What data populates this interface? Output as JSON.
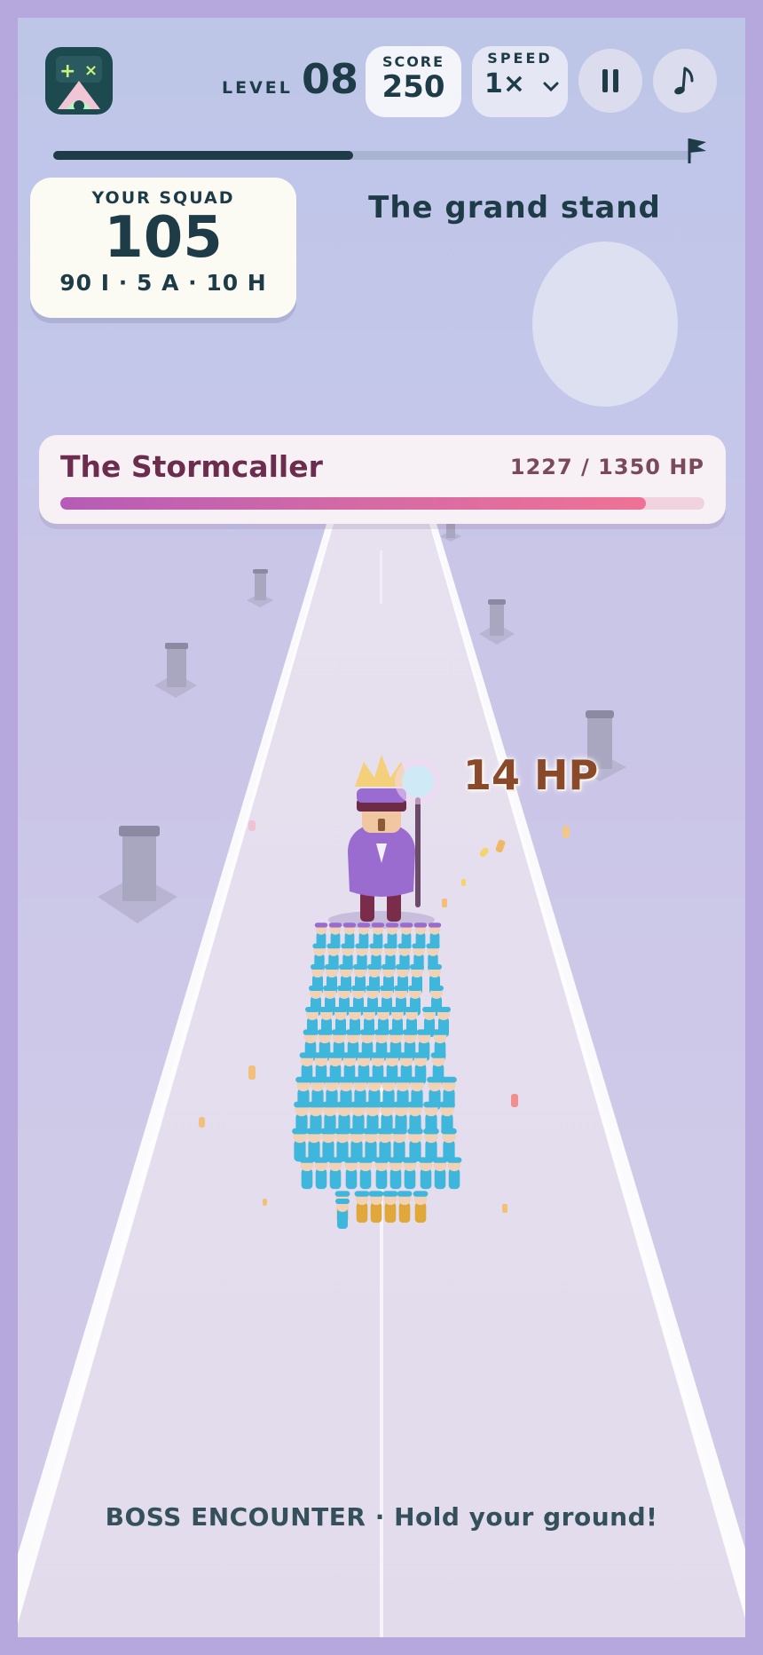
{
  "hud": {
    "level_label": "LEVEL",
    "level_value": "08",
    "score_label": "SCORE",
    "score_value": "250",
    "speed_label": "SPEED",
    "speed_value": "1×",
    "pause_icon": "pause-icon",
    "music_icon": "music-note-icon",
    "app_icon": "game-logo-icon"
  },
  "progress": {
    "fraction": 0.47,
    "end_icon": "flag-icon"
  },
  "squad": {
    "label": "YOUR SQUAD",
    "count": "105",
    "breakdown": "90 I · 5 A · 10 H"
  },
  "stage": {
    "title": "The grand stand"
  },
  "boss": {
    "name": "The Stormcaller",
    "hp_text": "1227 / 1350 HP",
    "hp_current": 1227,
    "hp_max": 1350
  },
  "floating_damage": "14 HP",
  "status": "BOSS ENCOUNTER · Hold your ground!",
  "colors": {
    "hud_text": "#1d3c47",
    "boss_name": "#6b2c4e",
    "squad_blue": "#3fb6dc",
    "archer_gold": "#e0a83a",
    "boss_purple": "#9b6cd0"
  }
}
